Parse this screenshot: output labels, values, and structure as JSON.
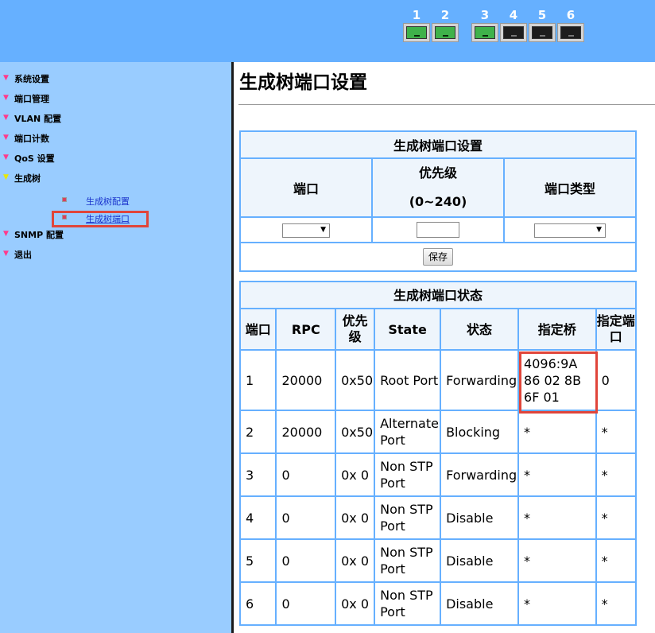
{
  "ports": [
    {
      "num": "1",
      "status": "up"
    },
    {
      "num": "2",
      "status": "up"
    },
    {
      "num": "3",
      "status": "up"
    },
    {
      "num": "4",
      "status": "down"
    },
    {
      "num": "5",
      "status": "down"
    },
    {
      "num": "6",
      "status": "down"
    }
  ],
  "sidebar": {
    "items": [
      {
        "label": "系统设置"
      },
      {
        "label": "端口管理"
      },
      {
        "label": "VLAN 配置"
      },
      {
        "label": "端口计数"
      },
      {
        "label": "QoS 设置"
      },
      {
        "label": "生成树"
      },
      {
        "label": "SNMP 配置"
      },
      {
        "label": "退出"
      }
    ],
    "subitems": [
      {
        "label": "生成树配置"
      },
      {
        "label": "生成树端口"
      }
    ]
  },
  "page": {
    "title": "生成树端口设置"
  },
  "config": {
    "title": "生成树端口设置",
    "col_port": "端口",
    "col_priority": "优先级",
    "col_priority_range": "(0~240)",
    "col_port_type": "端口类型",
    "save_label": "保存"
  },
  "status": {
    "title": "生成树端口状态",
    "headers": [
      "端口",
      "RPC",
      "优先级",
      "State",
      "状态",
      "指定桥",
      "指定端口"
    ],
    "rows": [
      [
        "1",
        "20000",
        "0x50",
        "Root Port",
        "Forwarding",
        "4096:9A 86 02 8B 6F 01",
        "0"
      ],
      [
        "2",
        "20000",
        "0x50",
        "Alternate Port",
        "Blocking",
        "*",
        "*"
      ],
      [
        "3",
        "0",
        "0x 0",
        "Non STP Port",
        "Forwarding",
        "*",
        "*"
      ],
      [
        "4",
        "0",
        "0x 0",
        "Non STP Port",
        "Disable",
        "*",
        "*"
      ],
      [
        "5",
        "0",
        "0x 0",
        "Non STP Port",
        "Disable",
        "*",
        "*"
      ],
      [
        "6",
        "0",
        "0x 0",
        "Non STP Port",
        "Disable",
        "*",
        "*"
      ]
    ]
  }
}
